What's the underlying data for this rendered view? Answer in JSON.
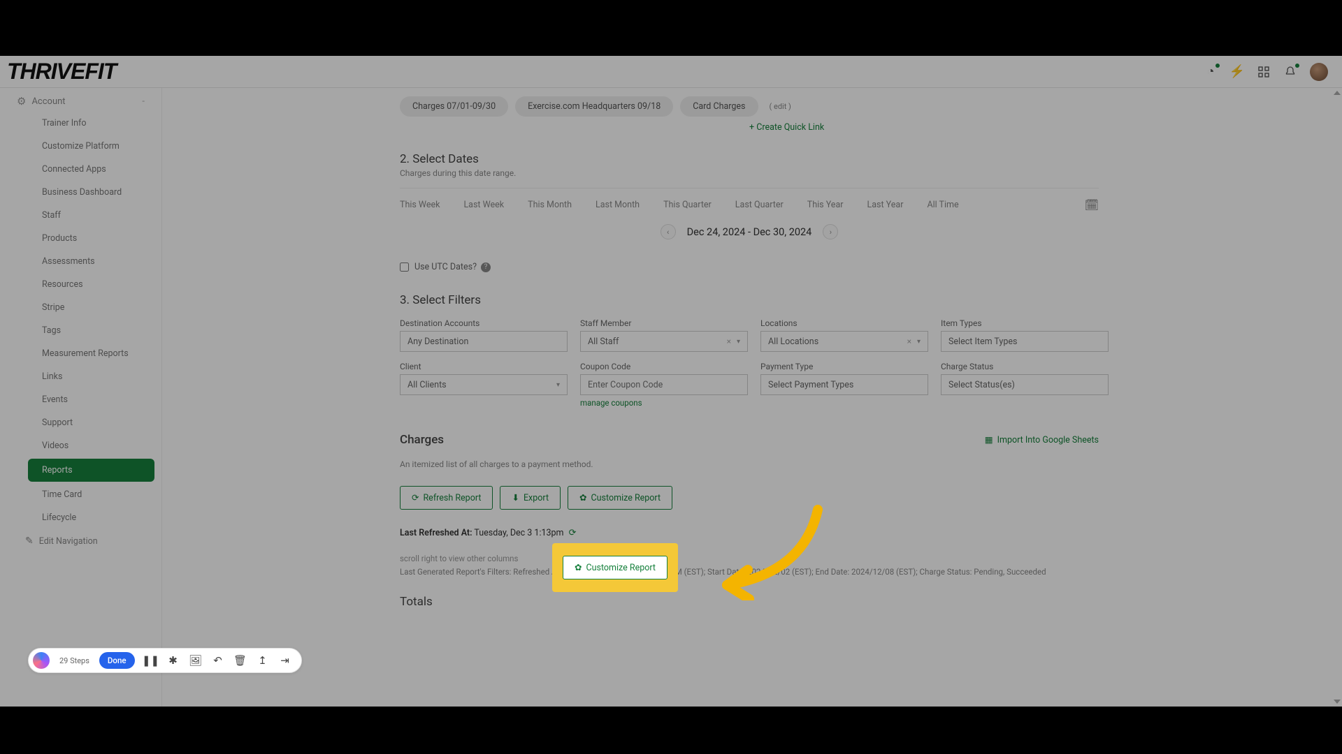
{
  "brand": "THRIVEFIT",
  "header_icons": [
    "timer",
    "bolt",
    "grid",
    "bell"
  ],
  "sidebar": {
    "section": {
      "label": "Account",
      "collapse": "-"
    },
    "items": [
      {
        "label": "Trainer Info"
      },
      {
        "label": "Customize Platform"
      },
      {
        "label": "Connected Apps"
      },
      {
        "label": "Business Dashboard"
      },
      {
        "label": "Staff"
      },
      {
        "label": "Products"
      },
      {
        "label": "Assessments"
      },
      {
        "label": "Resources"
      },
      {
        "label": "Stripe"
      },
      {
        "label": "Tags"
      },
      {
        "label": "Measurement Reports"
      },
      {
        "label": "Links"
      },
      {
        "label": "Events"
      },
      {
        "label": "Support"
      },
      {
        "label": "Videos"
      },
      {
        "label": "Reports",
        "active": true
      },
      {
        "label": "Time Card"
      },
      {
        "label": "Lifecycle"
      }
    ],
    "edit_nav": "Edit Navigation"
  },
  "quicklinks": {
    "pills": [
      "Charges 07/01-09/30",
      "Exercise.com Headquarters 09/18",
      "Card Charges"
    ],
    "edit": "( edit )",
    "create": "+ Create Quick Link"
  },
  "dates": {
    "title": "2. Select Dates",
    "subtitle": "Charges during this date range.",
    "presets": [
      "This Week",
      "Last Week",
      "This Month",
      "Last Month",
      "This Quarter",
      "Last Quarter",
      "This Year",
      "Last Year",
      "All Time"
    ],
    "range": "Dec 24, 2024 - Dec 30, 2024",
    "utc_label": "Use UTC Dates?"
  },
  "filters": {
    "title": "3. Select Filters",
    "dest": {
      "label": "Destination Accounts",
      "placeholder": "Any Destination"
    },
    "staff": {
      "label": "Staff Member",
      "value": "All Staff"
    },
    "locations": {
      "label": "Locations",
      "value": "All Locations"
    },
    "items": {
      "label": "Item Types",
      "placeholder": "Select Item Types"
    },
    "client": {
      "label": "Client",
      "value": "All Clients"
    },
    "coupon": {
      "label": "Coupon Code",
      "placeholder": "Enter Coupon Code",
      "manage": "manage coupons"
    },
    "payment": {
      "label": "Payment Type",
      "placeholder": "Select Payment Types"
    },
    "status": {
      "label": "Charge Status",
      "placeholder": "Select Status(es)"
    }
  },
  "charges": {
    "title": "Charges",
    "import": "Import Into Google Sheets",
    "desc": "An itemized list of all charges to a payment method.",
    "refresh": "Refresh Report",
    "export": "Export",
    "customize": "Customize Report",
    "last_refreshed_label": "Last Refreshed At:",
    "last_refreshed_value": " Tuesday, Dec 3 1:13pm ",
    "scroll_note": "scroll right to view other columns",
    "gen_filters": "Last Generated Report's Filters: Refreshed At: Tuesday Dec 3, 2024 at 01:13 PM (EST); Start Date: 2024/12/02 (EST); End Date: 2024/12/08 (EST); Charge Status: Pending, Succeeded",
    "totals": "Totals"
  },
  "recorder": {
    "steps": "29 Steps",
    "done": "Done"
  }
}
